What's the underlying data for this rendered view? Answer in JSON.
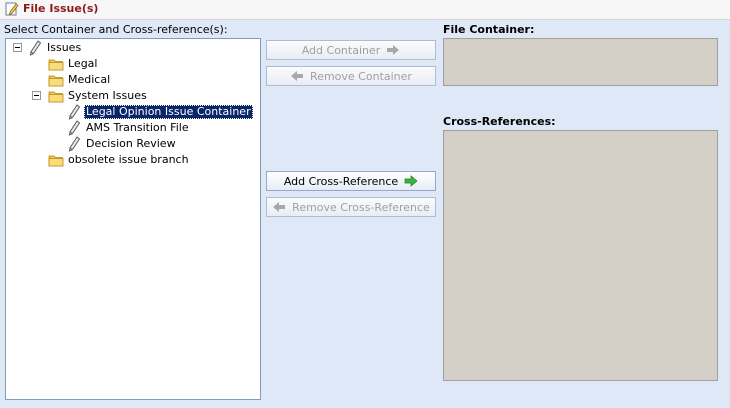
{
  "title": "File Issue(s)",
  "select_label": "Select Container and Cross-reference(s):",
  "file_container_label": "File Container:",
  "cross_references_label": "Cross-References:",
  "tree": {
    "root": "Issues",
    "legal": "Legal",
    "medical": "Medical",
    "system_issues": "System Issues",
    "legal_opinion": "Legal Opinion Issue Container",
    "ams_transition": "AMS Transition File",
    "decision_review": "Decision Review",
    "obsolete": "obsolete issue branch"
  },
  "buttons": {
    "add_container": "Add Container",
    "remove_container": "Remove Container",
    "add_cross_reference": "Add Cross-Reference",
    "remove_cross_reference": "Remove Cross-Reference"
  },
  "colors": {
    "title": "#8b1a1a",
    "selection": "#0a246a",
    "enabled_arrow": "#2fa82f",
    "disabled_arrow": "#a8a8a8",
    "list_box": "#d4d0c8"
  }
}
